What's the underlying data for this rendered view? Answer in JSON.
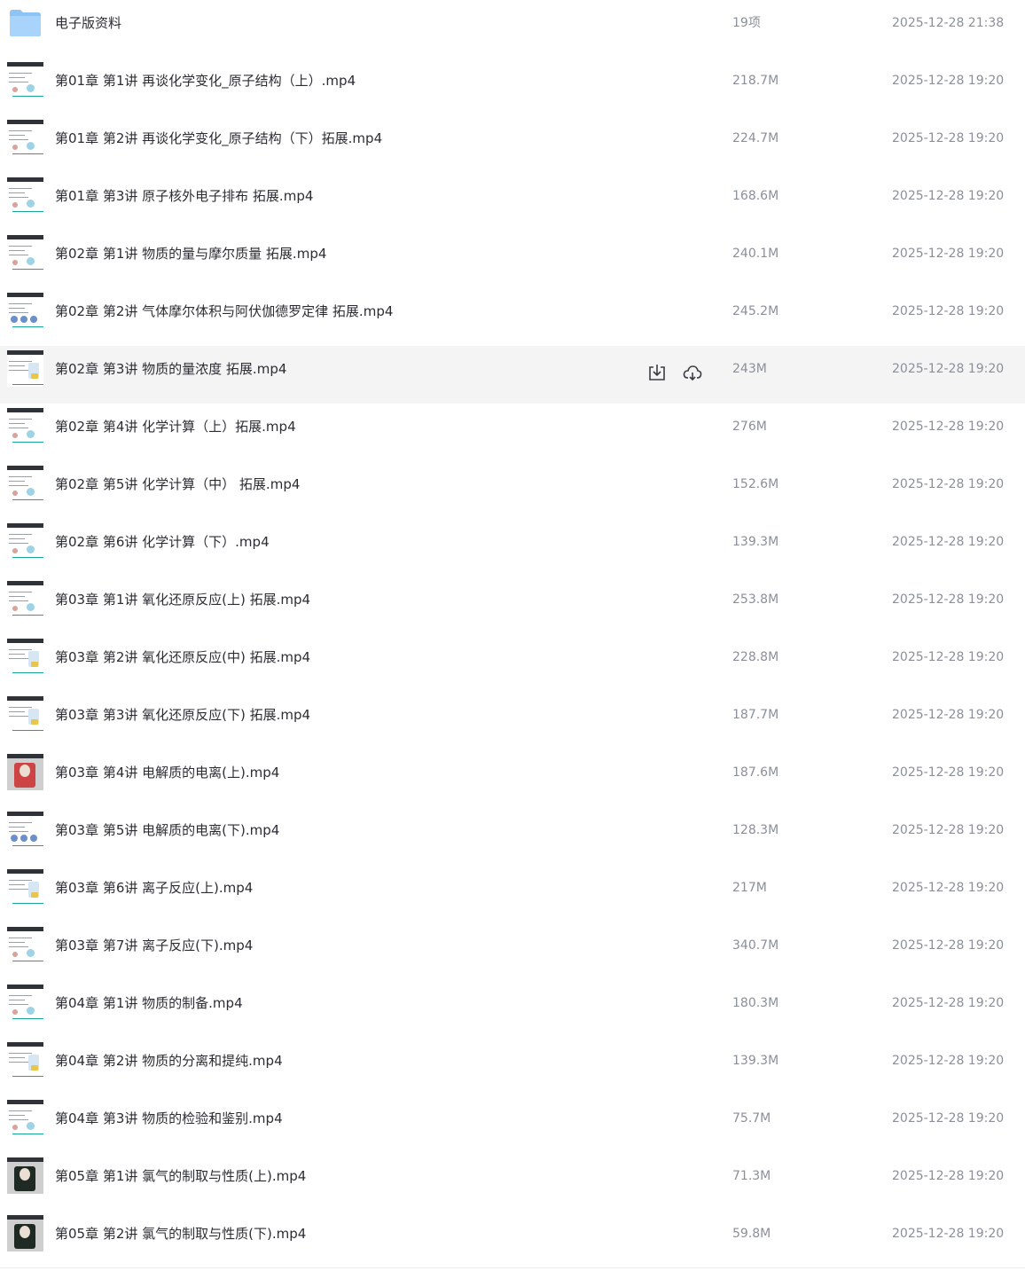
{
  "folder": {
    "name": "电子版资料",
    "count": "19项",
    "date": "2025-12-28 21:38",
    "icon": "folder-icon",
    "color": "#7fb9f0"
  },
  "files": [
    {
      "name": "第01章 第1讲 再谈化学变化_原子结构（上）.mp4",
      "size": "218.7M",
      "date": "2025-12-28 19:20"
    },
    {
      "name": "第01章 第2讲 再谈化学变化_原子结构（下）拓展.mp4",
      "size": "224.7M",
      "date": "2025-12-28 19:20"
    },
    {
      "name": "第01章 第3讲 原子核外电子排布 拓展.mp4",
      "size": "168.6M",
      "date": "2025-12-28 19:20"
    },
    {
      "name": "第02章 第1讲 物质的量与摩尔质量 拓展.mp4",
      "size": "240.1M",
      "date": "2025-12-28 19:20"
    },
    {
      "name": "第02章 第2讲 气体摩尔体积与阿伏伽德罗定律 拓展.mp4",
      "size": "245.2M",
      "date": "2025-12-28 19:20"
    },
    {
      "name": "第02章 第3讲 物质的量浓度 拓展.mp4",
      "size": "243M",
      "date": "2025-12-28 19:20"
    },
    {
      "name": "第02章 第4讲 化学计算（上）拓展.mp4",
      "size": "276M",
      "date": "2025-12-28 19:20"
    },
    {
      "name": "第02章 第5讲 化学计算（中） 拓展.mp4",
      "size": "152.6M",
      "date": "2025-12-28 19:20"
    },
    {
      "name": "第02章 第6讲 化学计算（下）.mp4",
      "size": "139.3M",
      "date": "2025-12-28 19:20"
    },
    {
      "name": "第03章 第1讲 氧化还原反应(上) 拓展.mp4",
      "size": "253.8M",
      "date": "2025-12-28 19:20"
    },
    {
      "name": "第03章 第2讲 氧化还原反应(中) 拓展.mp4",
      "size": "228.8M",
      "date": "2025-12-28 19:20"
    },
    {
      "name": "第03章 第3讲 氧化还原反应(下) 拓展.mp4",
      "size": "187.7M",
      "date": "2025-12-28 19:20"
    },
    {
      "name": "第03章 第4讲 电解质的电离(上).mp4",
      "size": "187.6M",
      "date": "2025-12-28 19:20"
    },
    {
      "name": "第03章 第5讲 电解质的电离(下).mp4",
      "size": "128.3M",
      "date": "2025-12-28 19:20"
    },
    {
      "name": "第03章 第6讲 离子反应(上).mp4",
      "size": "217M",
      "date": "2025-12-28 19:20"
    },
    {
      "name": "第03章 第7讲 离子反应(下).mp4",
      "size": "340.7M",
      "date": "2025-12-28 19:20"
    },
    {
      "name": "第04章 第1讲 物质的制备.mp4",
      "size": "180.3M",
      "date": "2025-12-28 19:20"
    },
    {
      "name": "第04章 第2讲 物质的分离和提纯.mp4",
      "size": "139.3M",
      "date": "2025-12-28 19:20"
    },
    {
      "name": "第04章 第3讲 物质的检验和鉴别.mp4",
      "size": "75.7M",
      "date": "2025-12-28 19:20"
    },
    {
      "name": "第05章 第1讲 氯气的制取与性质(上).mp4",
      "size": "71.3M",
      "date": "2025-12-28 19:20"
    },
    {
      "name": "第05章 第2讲 氯气的制取与性质(下).mp4",
      "size": "59.8M",
      "date": "2025-12-28 19:20"
    }
  ],
  "hover_row_index": 5,
  "row_actions": [
    {
      "icon": "download-icon"
    },
    {
      "icon": "cloud-save-icon"
    }
  ],
  "colors": {
    "hover_bg": "#f4f4f5",
    "text_primary": "#2b2d33",
    "text_secondary": "#8a8f99",
    "icon": "#3a3d45"
  }
}
